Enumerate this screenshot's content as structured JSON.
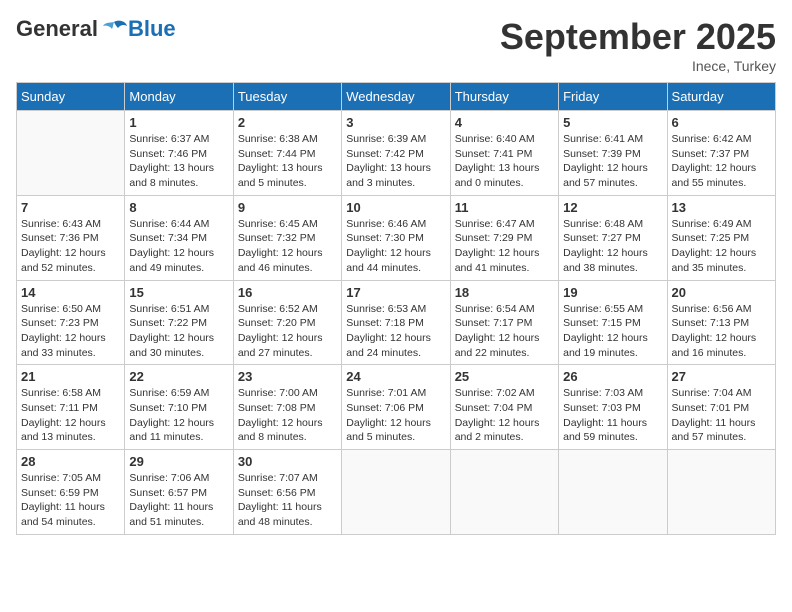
{
  "logo": {
    "general": "General",
    "blue": "Blue"
  },
  "title": "September 2025",
  "location": "Inece, Turkey",
  "days_of_week": [
    "Sunday",
    "Monday",
    "Tuesday",
    "Wednesday",
    "Thursday",
    "Friday",
    "Saturday"
  ],
  "weeks": [
    [
      {
        "day": "",
        "info": ""
      },
      {
        "day": "1",
        "info": "Sunrise: 6:37 AM\nSunset: 7:46 PM\nDaylight: 13 hours\nand 8 minutes."
      },
      {
        "day": "2",
        "info": "Sunrise: 6:38 AM\nSunset: 7:44 PM\nDaylight: 13 hours\nand 5 minutes."
      },
      {
        "day": "3",
        "info": "Sunrise: 6:39 AM\nSunset: 7:42 PM\nDaylight: 13 hours\nand 3 minutes."
      },
      {
        "day": "4",
        "info": "Sunrise: 6:40 AM\nSunset: 7:41 PM\nDaylight: 13 hours\nand 0 minutes."
      },
      {
        "day": "5",
        "info": "Sunrise: 6:41 AM\nSunset: 7:39 PM\nDaylight: 12 hours\nand 57 minutes."
      },
      {
        "day": "6",
        "info": "Sunrise: 6:42 AM\nSunset: 7:37 PM\nDaylight: 12 hours\nand 55 minutes."
      }
    ],
    [
      {
        "day": "7",
        "info": "Sunrise: 6:43 AM\nSunset: 7:36 PM\nDaylight: 12 hours\nand 52 minutes."
      },
      {
        "day": "8",
        "info": "Sunrise: 6:44 AM\nSunset: 7:34 PM\nDaylight: 12 hours\nand 49 minutes."
      },
      {
        "day": "9",
        "info": "Sunrise: 6:45 AM\nSunset: 7:32 PM\nDaylight: 12 hours\nand 46 minutes."
      },
      {
        "day": "10",
        "info": "Sunrise: 6:46 AM\nSunset: 7:30 PM\nDaylight: 12 hours\nand 44 minutes."
      },
      {
        "day": "11",
        "info": "Sunrise: 6:47 AM\nSunset: 7:29 PM\nDaylight: 12 hours\nand 41 minutes."
      },
      {
        "day": "12",
        "info": "Sunrise: 6:48 AM\nSunset: 7:27 PM\nDaylight: 12 hours\nand 38 minutes."
      },
      {
        "day": "13",
        "info": "Sunrise: 6:49 AM\nSunset: 7:25 PM\nDaylight: 12 hours\nand 35 minutes."
      }
    ],
    [
      {
        "day": "14",
        "info": "Sunrise: 6:50 AM\nSunset: 7:23 PM\nDaylight: 12 hours\nand 33 minutes."
      },
      {
        "day": "15",
        "info": "Sunrise: 6:51 AM\nSunset: 7:22 PM\nDaylight: 12 hours\nand 30 minutes."
      },
      {
        "day": "16",
        "info": "Sunrise: 6:52 AM\nSunset: 7:20 PM\nDaylight: 12 hours\nand 27 minutes."
      },
      {
        "day": "17",
        "info": "Sunrise: 6:53 AM\nSunset: 7:18 PM\nDaylight: 12 hours\nand 24 minutes."
      },
      {
        "day": "18",
        "info": "Sunrise: 6:54 AM\nSunset: 7:17 PM\nDaylight: 12 hours\nand 22 minutes."
      },
      {
        "day": "19",
        "info": "Sunrise: 6:55 AM\nSunset: 7:15 PM\nDaylight: 12 hours\nand 19 minutes."
      },
      {
        "day": "20",
        "info": "Sunrise: 6:56 AM\nSunset: 7:13 PM\nDaylight: 12 hours\nand 16 minutes."
      }
    ],
    [
      {
        "day": "21",
        "info": "Sunrise: 6:58 AM\nSunset: 7:11 PM\nDaylight: 12 hours\nand 13 minutes."
      },
      {
        "day": "22",
        "info": "Sunrise: 6:59 AM\nSunset: 7:10 PM\nDaylight: 12 hours\nand 11 minutes."
      },
      {
        "day": "23",
        "info": "Sunrise: 7:00 AM\nSunset: 7:08 PM\nDaylight: 12 hours\nand 8 minutes."
      },
      {
        "day": "24",
        "info": "Sunrise: 7:01 AM\nSunset: 7:06 PM\nDaylight: 12 hours\nand 5 minutes."
      },
      {
        "day": "25",
        "info": "Sunrise: 7:02 AM\nSunset: 7:04 PM\nDaylight: 12 hours\nand 2 minutes."
      },
      {
        "day": "26",
        "info": "Sunrise: 7:03 AM\nSunset: 7:03 PM\nDaylight: 11 hours\nand 59 minutes."
      },
      {
        "day": "27",
        "info": "Sunrise: 7:04 AM\nSunset: 7:01 PM\nDaylight: 11 hours\nand 57 minutes."
      }
    ],
    [
      {
        "day": "28",
        "info": "Sunrise: 7:05 AM\nSunset: 6:59 PM\nDaylight: 11 hours\nand 54 minutes."
      },
      {
        "day": "29",
        "info": "Sunrise: 7:06 AM\nSunset: 6:57 PM\nDaylight: 11 hours\nand 51 minutes."
      },
      {
        "day": "30",
        "info": "Sunrise: 7:07 AM\nSunset: 6:56 PM\nDaylight: 11 hours\nand 48 minutes."
      },
      {
        "day": "",
        "info": ""
      },
      {
        "day": "",
        "info": ""
      },
      {
        "day": "",
        "info": ""
      },
      {
        "day": "",
        "info": ""
      }
    ]
  ]
}
